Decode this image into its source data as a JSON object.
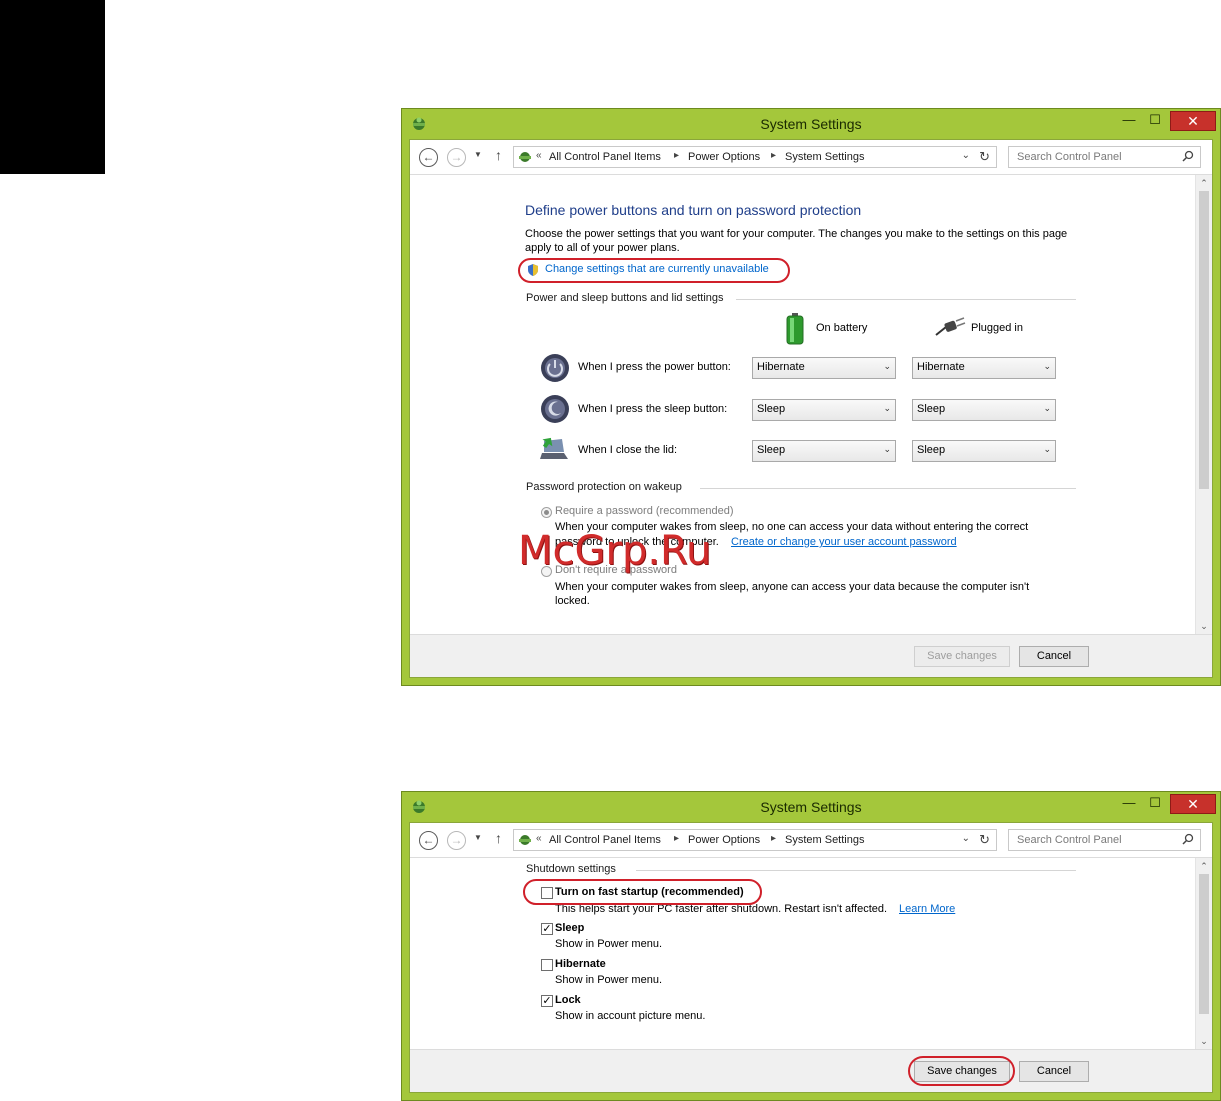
{
  "watermark": "McGrp.Ru",
  "windows": [
    {
      "title": "System Settings",
      "breadcrumb": [
        "All Control Panel Items",
        "Power Options",
        "System Settings"
      ],
      "search_placeholder": "Search Control Panel",
      "heading": "Define power buttons and turn on password protection",
      "intro": "Choose the power settings that you want for your computer. The changes you make to the settings on this page apply to all of your power plans.",
      "change_link": "Change settings that are currently unavailable",
      "buttons_section": "Power and sleep buttons and lid settings",
      "col_battery": "On battery",
      "col_plugged": "Plugged in",
      "rows": [
        {
          "label": "When I press the power button:",
          "battery": "Hibernate",
          "plugged": "Hibernate"
        },
        {
          "label": "When I press the sleep button:",
          "battery": "Sleep",
          "plugged": "Sleep"
        },
        {
          "label": "When I close the lid:",
          "battery": "Sleep",
          "plugged": "Sleep"
        }
      ],
      "password_section": "Password protection on wakeup",
      "require_pw_label": "Require a password (recommended)",
      "require_pw_desc_1": "When your computer wakes from sleep, no one can access your data without entering the correct",
      "require_pw_desc_2": "password to unlock the computer.",
      "require_pw_link": "Create or change your user account password",
      "no_pw_label": "Don't require a password",
      "no_pw_desc": "When your computer wakes from sleep, anyone can access your data because the computer isn't locked.",
      "save": "Save changes",
      "cancel": "Cancel"
    },
    {
      "title": "System Settings",
      "breadcrumb": [
        "All Control Panel Items",
        "Power Options",
        "System Settings"
      ],
      "search_placeholder": "Search Control Panel",
      "shutdown_section": "Shutdown settings",
      "options": [
        {
          "label": "Turn on fast startup (recommended)",
          "desc": "This helps start your PC faster after shutdown. Restart isn't affected.",
          "link": "Learn More",
          "checked": false
        },
        {
          "label": "Sleep",
          "desc": "Show in Power menu.",
          "checked": true
        },
        {
          "label": "Hibernate",
          "desc": "Show in Power menu.",
          "checked": false
        },
        {
          "label": "Lock",
          "desc": "Show in account picture menu.",
          "checked": true
        }
      ],
      "save": "Save changes",
      "cancel": "Cancel"
    }
  ]
}
